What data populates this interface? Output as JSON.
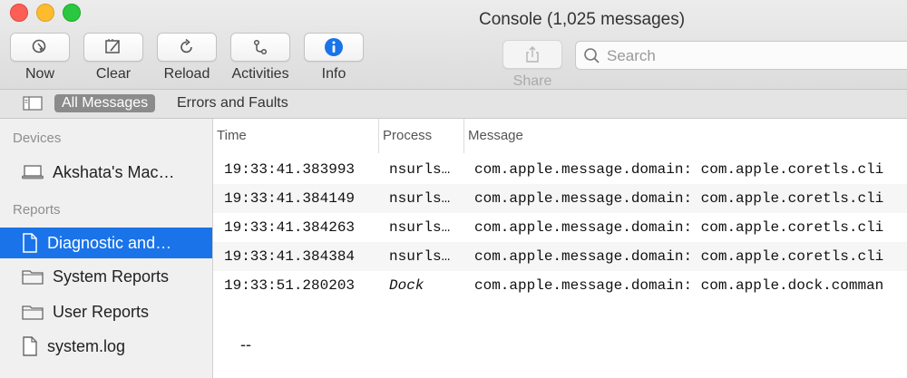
{
  "window": {
    "title": "Console (1,025 messages)"
  },
  "toolbar": {
    "now_label": "Now",
    "clear_label": "Clear",
    "reload_label": "Reload",
    "activities_label": "Activities",
    "info_label": "Info",
    "share_label": "Share",
    "accent_color": "#1a73e8"
  },
  "search": {
    "placeholder": "Search",
    "value": ""
  },
  "filters": {
    "all_messages": "All Messages",
    "errors_and_faults": "Errors and Faults"
  },
  "sidebar": {
    "devices_header": "Devices",
    "device_name": "Akshata's Mac…",
    "reports_header": "Reports",
    "reports": [
      {
        "label": "Diagnostic and…",
        "icon": "document-icon",
        "selected": true
      },
      {
        "label": "System Reports",
        "icon": "folder-icon",
        "selected": false
      },
      {
        "label": "User Reports",
        "icon": "folder-icon",
        "selected": false
      },
      {
        "label": "system.log",
        "icon": "document-icon",
        "selected": false
      }
    ]
  },
  "table": {
    "columns": [
      "Time",
      "Process",
      "Message"
    ],
    "rows": [
      {
        "time": "19:33:41.383993",
        "process": "nsurls…",
        "message": "com.apple.message.domain: com.apple.coretls.cli"
      },
      {
        "time": "19:33:41.384149",
        "process": "nsurls…",
        "message": "com.apple.message.domain: com.apple.coretls.cli"
      },
      {
        "time": "19:33:41.384263",
        "process": "nsurls…",
        "message": "com.apple.message.domain: com.apple.coretls.cli"
      },
      {
        "time": "19:33:41.384384",
        "process": "nsurls…",
        "message": "com.apple.message.domain: com.apple.coretls.cli"
      },
      {
        "time": "19:33:51.280203",
        "process": "Dock",
        "message": "com.apple.message.domain: com.apple.dock.comman"
      }
    ]
  },
  "detail": {
    "placeholder": "--"
  }
}
